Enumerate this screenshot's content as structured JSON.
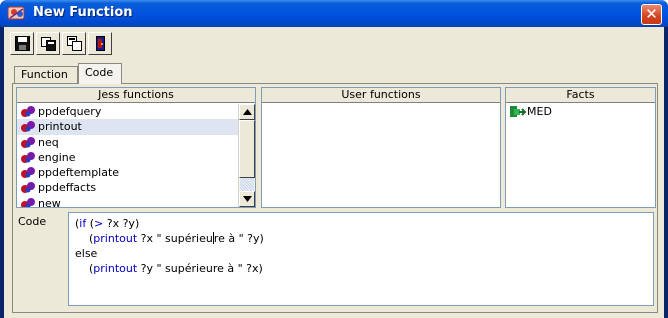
{
  "window": {
    "title": "New Function",
    "icon": "jess-app-icon",
    "close_label": "✕"
  },
  "toolbar": {
    "buttons": [
      {
        "name": "save-icon"
      },
      {
        "name": "copy-icon"
      },
      {
        "name": "paste-icon"
      },
      {
        "name": "exit-icon"
      }
    ]
  },
  "tabs": [
    {
      "label": "Function"
    },
    {
      "label": "Code"
    }
  ],
  "jess_functions": {
    "header": "Jess functions",
    "items": [
      "ppdefquery",
      "printout",
      "neq",
      "engine",
      "ppdeftemplate",
      "ppdeffacts",
      "new"
    ],
    "selected_index": 1
  },
  "user_functions": {
    "header": "User functions",
    "items": []
  },
  "facts": {
    "header": "Facts",
    "items": [
      "MED"
    ]
  },
  "code": {
    "label": "Code",
    "lines": [
      {
        "parts": [
          {
            "t": "(",
            "kw": false
          },
          {
            "t": "if",
            "kw": true
          },
          {
            "t": " (",
            "kw": false
          },
          {
            "t": ">",
            "kw": true
          },
          {
            "t": " ?x ?y)",
            "kw": false
          }
        ]
      },
      {
        "parts": [
          {
            "t": "    (",
            "kw": false
          },
          {
            "t": "printout",
            "kw": true
          },
          {
            "t": " ?x \" supérieu",
            "kw": false
          },
          {
            "t": "re à \" ?y)",
            "kw": false
          }
        ],
        "caret_after": 2
      },
      {
        "parts": [
          {
            "t": "else",
            "kw": false
          }
        ]
      },
      {
        "parts": [
          {
            "t": "    (",
            "kw": false
          },
          {
            "t": "printout",
            "kw": true
          },
          {
            "t": " ?y \" supérieure à \" ?x)",
            "kw": false
          }
        ]
      }
    ]
  },
  "colors": {
    "title_bar": "#0053e1",
    "keyword": "#0000c0",
    "selection": "#dfe5f0",
    "window_bg": "#ece9d8"
  }
}
